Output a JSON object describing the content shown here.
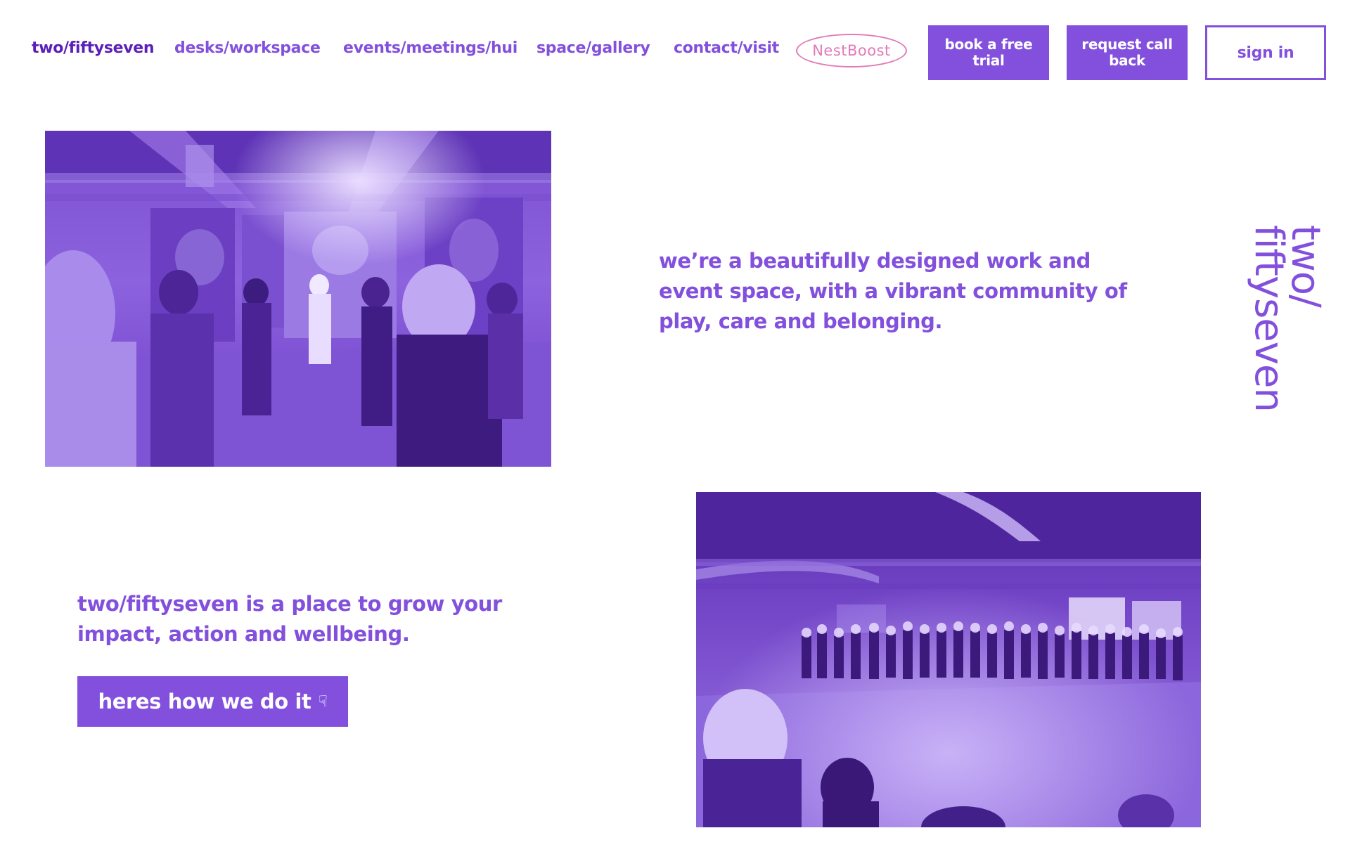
{
  "nav": {
    "home": "two/fiftyseven",
    "desks": "desks/workspace",
    "events": "events/meetings/hui",
    "space": "space/gallery",
    "contact": "contact/visit",
    "nestboost": "NestBoost",
    "book_trial": "book a free trial",
    "request_callback": "request call back",
    "sign_in": "sign in"
  },
  "hero": {
    "intro": "we’re a beautifully designed work and event space, with a vibrant community of play, care and belonging."
  },
  "impact": {
    "text": "two/fiftyseven is a place to grow your impact, action and wellbeing.",
    "button_label": "heres how we do it",
    "button_icon": "pointing-hand-down-icon"
  },
  "wordmark": {
    "line1": "two/",
    "line2": "fiftyseven"
  },
  "photos": {
    "top": "event-crowd-photo",
    "bottom": "circle-gathering-photo"
  },
  "colors": {
    "brand_purple": "#8250dc",
    "dark_purple": "#5a1fb8",
    "nestboost_pink": "#e27ab8"
  }
}
